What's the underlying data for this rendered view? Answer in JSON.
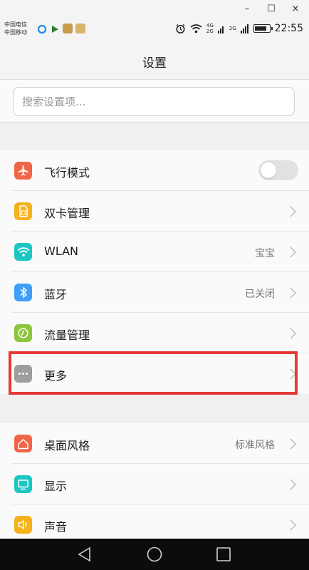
{
  "window": {
    "minimize_glyph": "–",
    "maximize_glyph": "☐",
    "close_glyph": "×"
  },
  "status_bar": {
    "carrier_1": "中国电信",
    "carrier_2": "中国移动",
    "notification_icons": [
      "browser-icon",
      "media-icon",
      "app-icon",
      "app-icon-2"
    ],
    "network_1": "4G",
    "network_2": "2G",
    "network_3": "2G",
    "time": "22:55"
  },
  "header": {
    "title": "设置"
  },
  "search": {
    "placeholder": "搜索设置项..."
  },
  "group1": [
    {
      "label": "飞行模式",
      "icon": "airplane-icon",
      "color": "#f06548",
      "control": "toggle",
      "toggle_on": false
    },
    {
      "label": "双卡管理",
      "icon": "sim-card-icon",
      "color": "#f5b21b",
      "control": "chevron"
    },
    {
      "label": "WLAN",
      "icon": "wifi-icon",
      "color": "#1ec6c3",
      "control": "chevron",
      "value": "宝宝"
    },
    {
      "label": "蓝牙",
      "icon": "bluetooth-icon",
      "color": "#3f9ef5",
      "control": "chevron",
      "value": "已关闭"
    },
    {
      "label": "流量管理",
      "icon": "data-usage-icon",
      "color": "#8cc63f",
      "control": "chevron"
    },
    {
      "label": "更多",
      "icon": "more-icon",
      "color": "#9e9e9e",
      "control": "chevron"
    }
  ],
  "group2": [
    {
      "label": "桌面风格",
      "icon": "home-style-icon",
      "color": "#f06548",
      "control": "chevron",
      "value": "标准风格"
    },
    {
      "label": "显示",
      "icon": "display-icon",
      "color": "#1ec6c3",
      "control": "chevron"
    },
    {
      "label": "声音",
      "icon": "sound-icon",
      "color": "#f5b21b",
      "control": "chevron"
    }
  ],
  "colors": {
    "highlight_border": "#e53935",
    "nav_bar": "#0c0c0c"
  },
  "nav": {
    "back": "back-icon",
    "home": "home-icon",
    "recent": "recent-apps-icon"
  }
}
